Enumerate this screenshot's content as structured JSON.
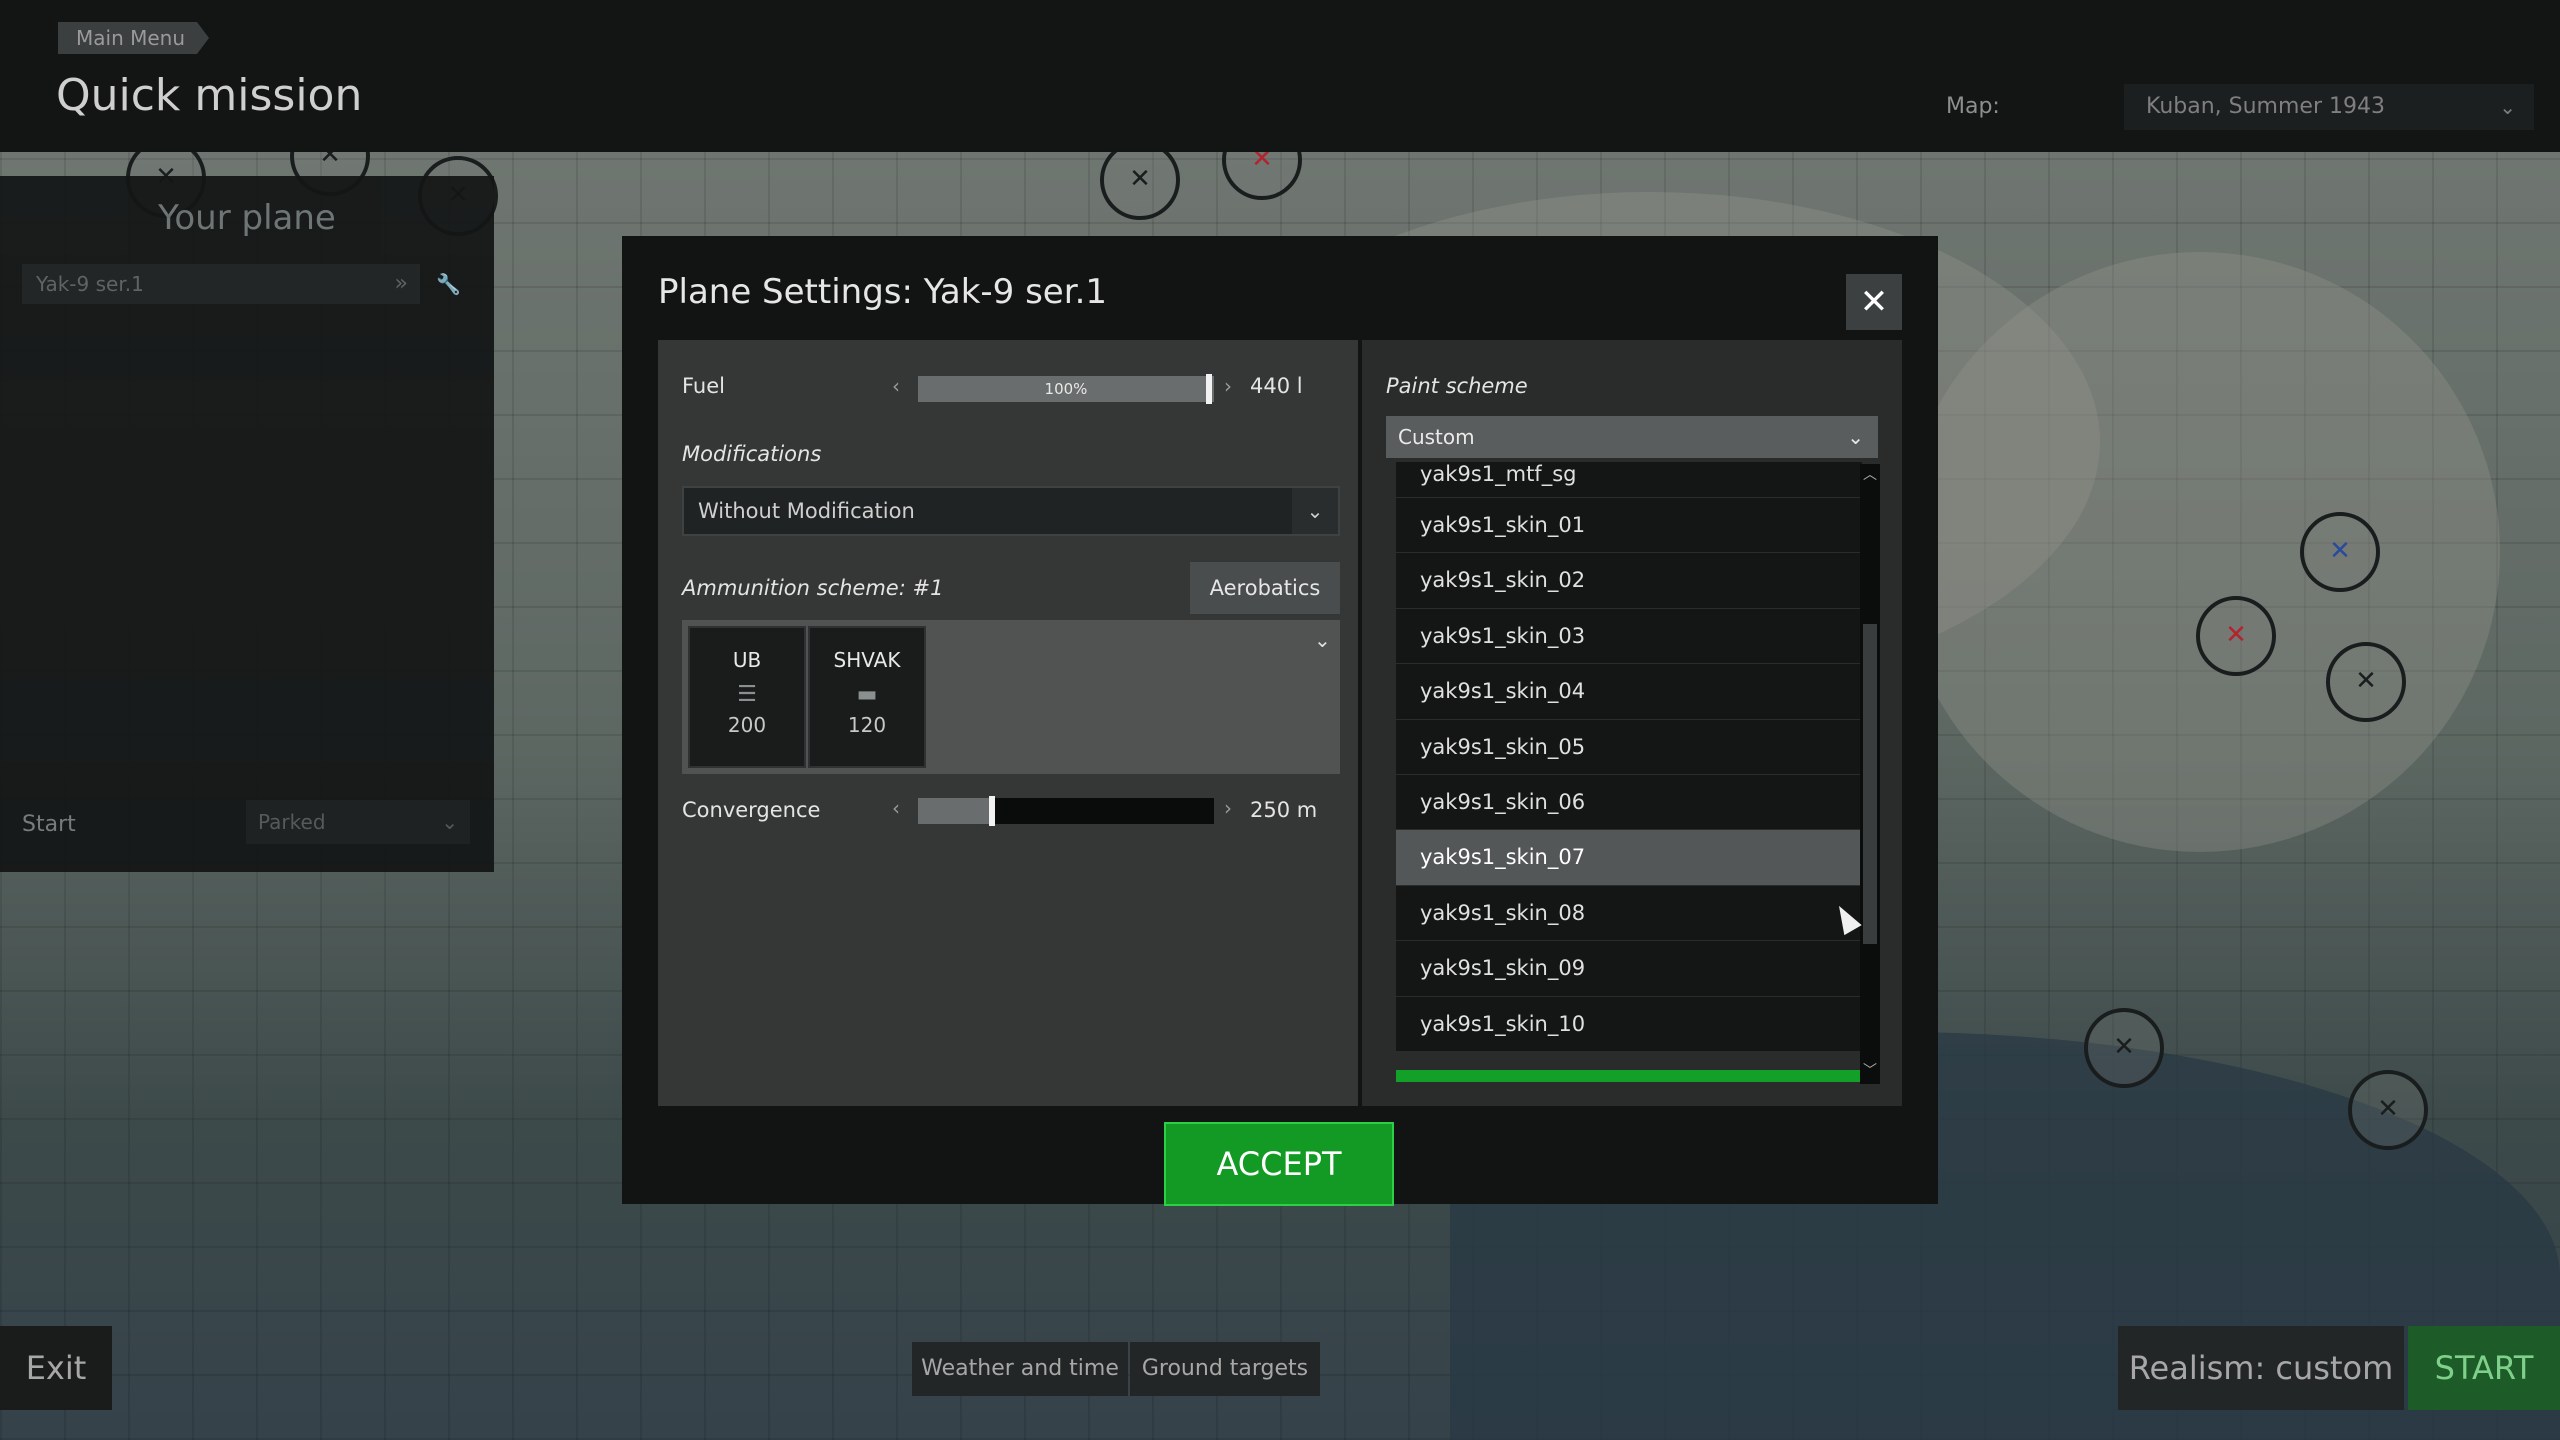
{
  "header": {
    "breadcrumb": "Main Menu",
    "title": "Quick mission",
    "map_label": "Map:",
    "map_value": "Kuban, Summer 1943"
  },
  "left_panel": {
    "heading": "Your plane",
    "plane": "Yak-9 ser.1",
    "start_label": "Start",
    "start_value": "Parked"
  },
  "bottom": {
    "exit": "Exit",
    "weather": "Weather and time",
    "ground": "Ground targets",
    "realism": "Realism: custom",
    "start": "START"
  },
  "dialog": {
    "title": "Plane Settings: Yak-9 ser.1",
    "fuel": {
      "label": "Fuel",
      "percent_text": "100%",
      "percent": 100,
      "value": "440 l"
    },
    "modifications": {
      "label": "Modifications",
      "value": "Without Modification"
    },
    "ammo": {
      "label": "Ammunition scheme: #1",
      "preset_button": "Aerobatics",
      "guns": [
        {
          "name": "UB",
          "count": "200"
        },
        {
          "name": "SHVAK",
          "count": "120"
        }
      ]
    },
    "convergence": {
      "label": "Convergence",
      "value": "250 m",
      "fraction": 0.25
    },
    "paint": {
      "label": "Paint scheme",
      "value": "Custom",
      "skins": [
        "yak9s1_mtf_sg",
        "yak9s1_skin_01",
        "yak9s1_skin_02",
        "yak9s1_skin_03",
        "yak9s1_skin_04",
        "yak9s1_skin_05",
        "yak9s1_skin_06",
        "yak9s1_skin_07",
        "yak9s1_skin_08",
        "yak9s1_skin_09",
        "yak9s1_skin_10"
      ],
      "selected": "yak9s1_skin_07"
    },
    "accept": "ACCEPT"
  }
}
